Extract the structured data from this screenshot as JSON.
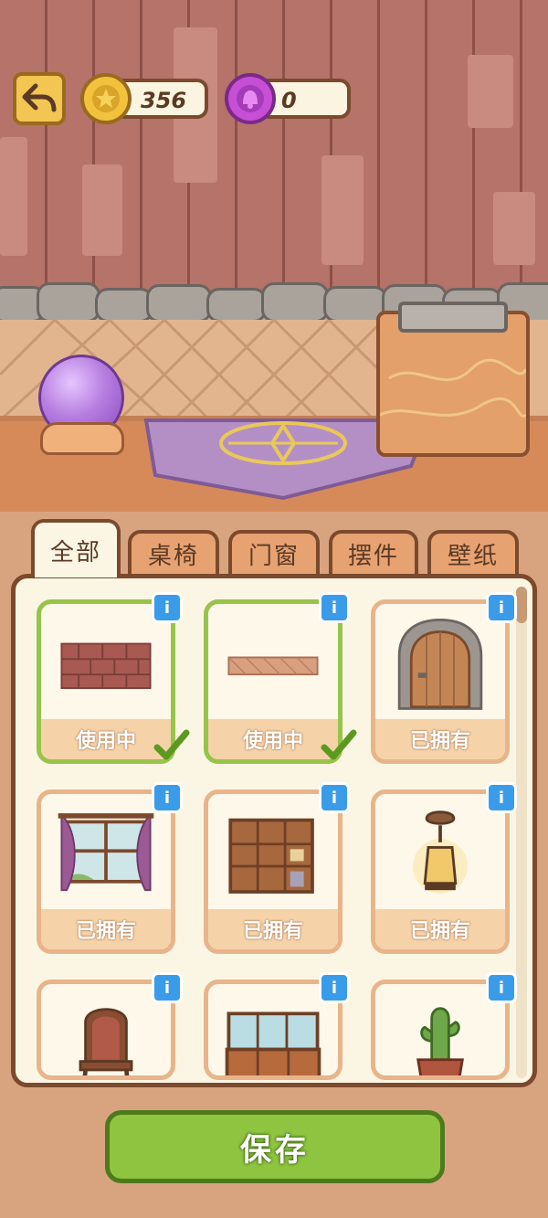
{
  "hud": {
    "coins": "356",
    "gems": "0"
  },
  "tabs": [
    {
      "label": "全部",
      "active": true
    },
    {
      "label": "桌椅",
      "active": false
    },
    {
      "label": "门窗",
      "active": false
    },
    {
      "label": "摆件",
      "active": false
    },
    {
      "label": "壁纸",
      "active": false
    }
  ],
  "items": [
    {
      "status": "使用中",
      "in_use": true,
      "icon": "brick-wallpaper-icon"
    },
    {
      "status": "使用中",
      "in_use": true,
      "icon": "floor-tile-icon"
    },
    {
      "status": "已拥有",
      "in_use": false,
      "icon": "stone-arch-door-icon"
    },
    {
      "status": "已拥有",
      "in_use": false,
      "icon": "curtained-window-icon"
    },
    {
      "status": "已拥有",
      "in_use": false,
      "icon": "wooden-cabinet-icon"
    },
    {
      "status": "已拥有",
      "in_use": false,
      "icon": "lantern-icon"
    },
    {
      "status": "",
      "in_use": false,
      "icon": "wooden-chair-icon"
    },
    {
      "status": "",
      "in_use": false,
      "icon": "display-counter-icon"
    },
    {
      "status": "",
      "in_use": false,
      "icon": "potted-cactus-icon"
    }
  ],
  "save_label": "保存",
  "colors": {
    "accent_green": "#8fc440",
    "info_blue": "#3a9ce8",
    "border_brown": "#7b4a2c"
  }
}
